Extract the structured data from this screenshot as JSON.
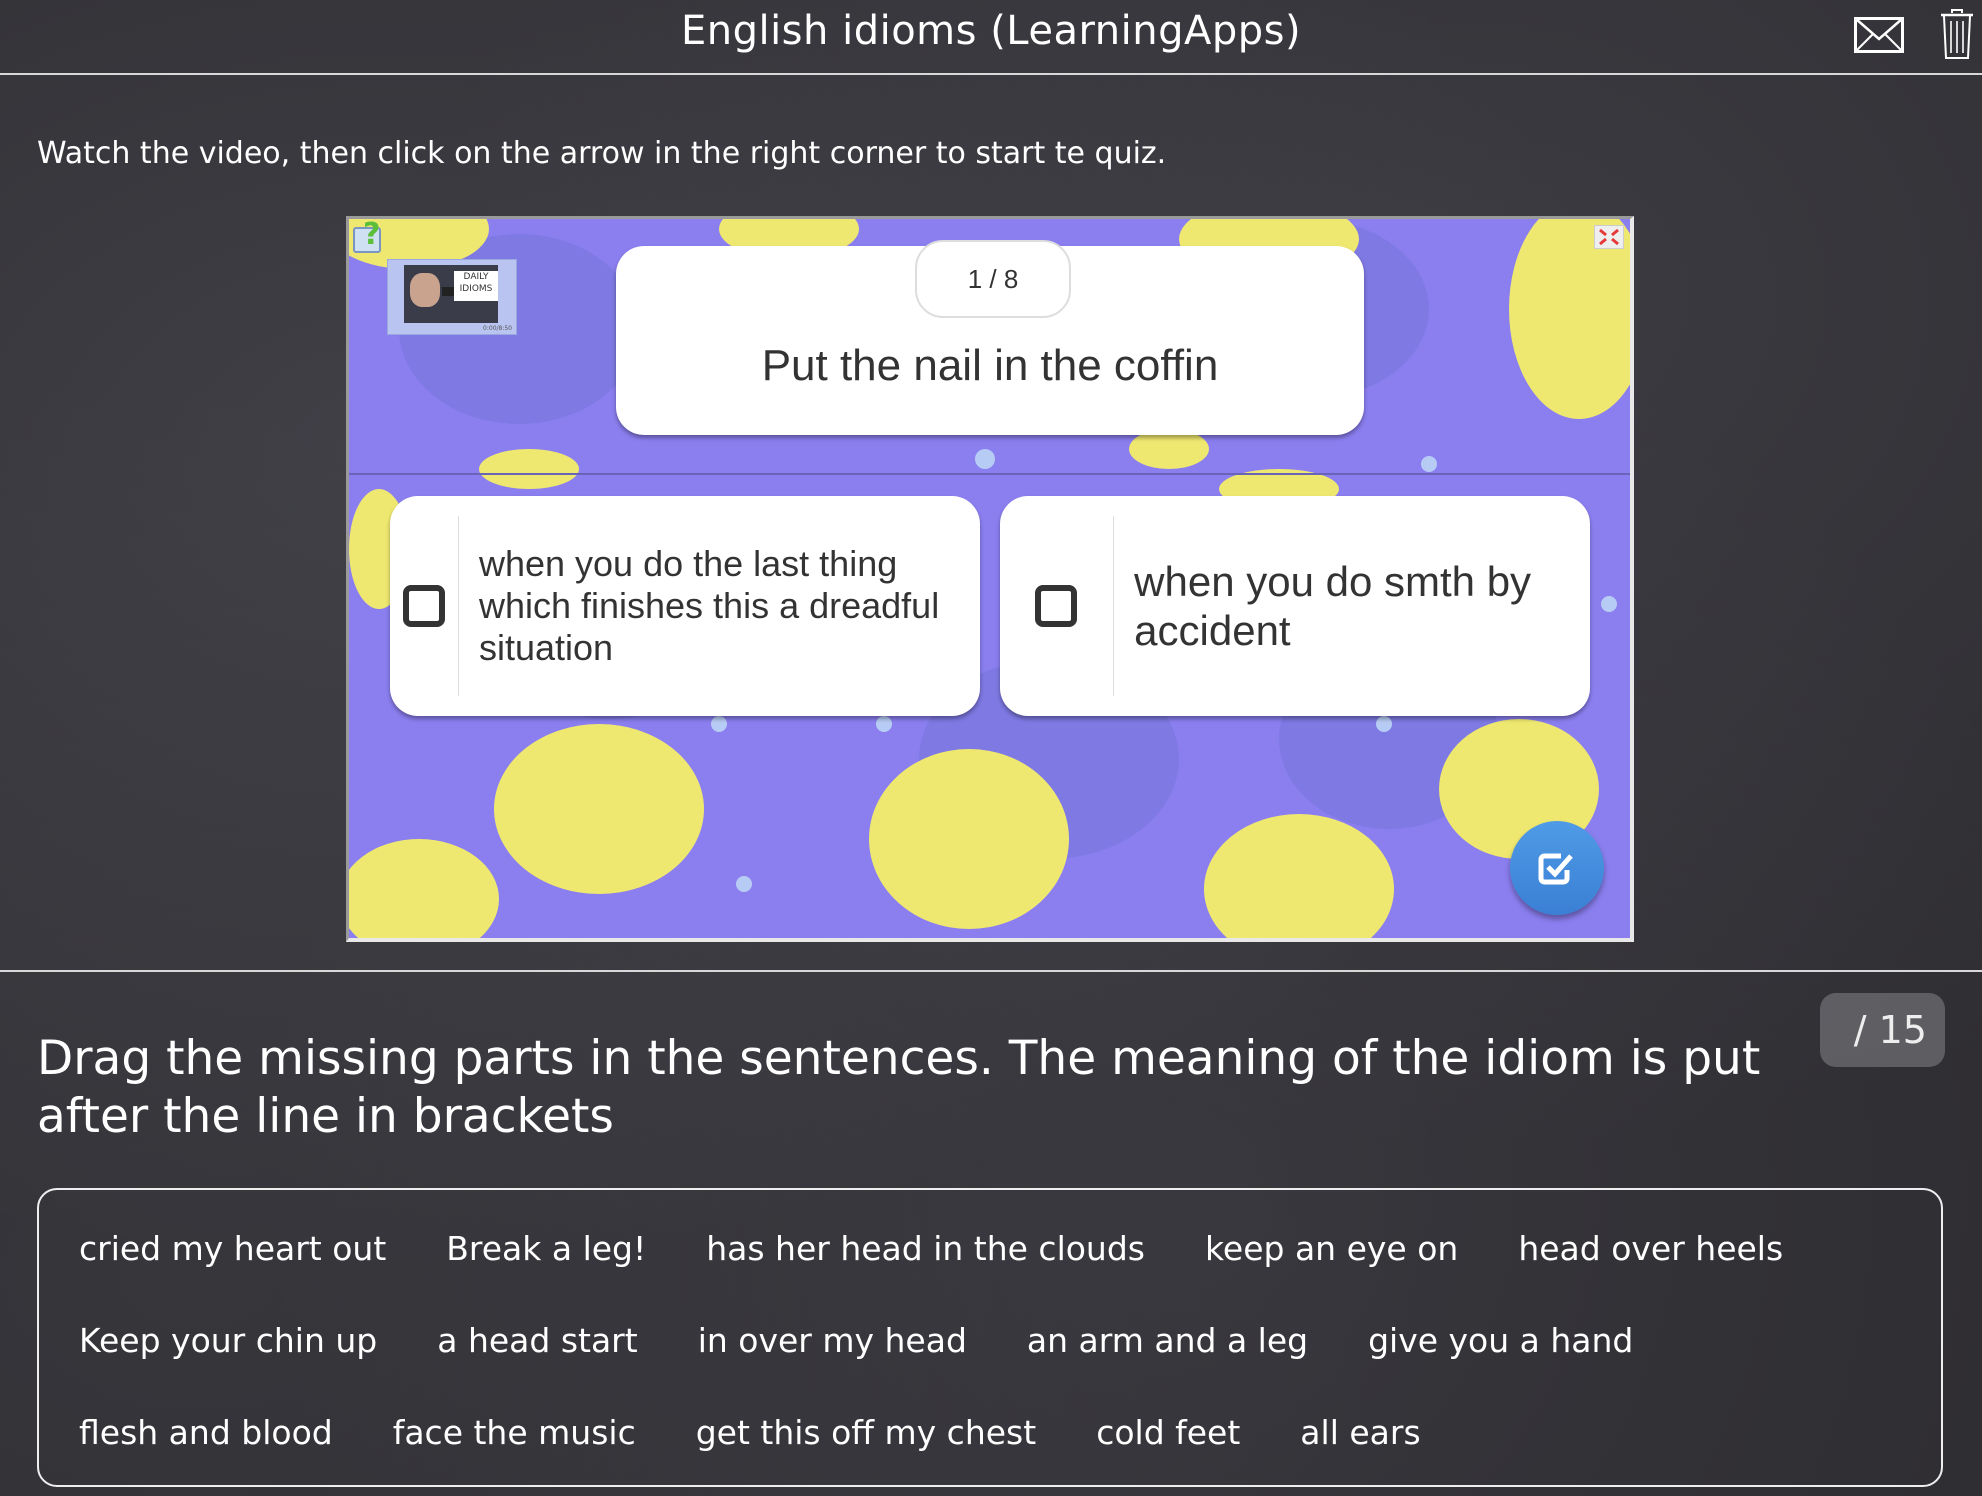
{
  "header": {
    "title": "English idioms (LearningApps)",
    "icons": [
      "mail-icon",
      "trash-icon"
    ]
  },
  "instruction": "Watch the video, then click on the arrow in the right corner to start te quiz.",
  "quiz": {
    "counter": "1 / 8",
    "question": "Put the nail in the coffin",
    "video_thumbnail": {
      "title_line1": "DAILY",
      "title_line2": "IDIOMS",
      "time": "0:00/8:50"
    },
    "answers": [
      {
        "text": "when you do the last thing which finishes this a dreadful situation",
        "checked": false
      },
      {
        "text": "when you do smth by accident",
        "checked": false
      }
    ],
    "icons": [
      "help-icon",
      "fullscreen-icon",
      "check-submit-icon"
    ],
    "colors": {
      "background": "#8b7ff0",
      "leaf": "#efe870",
      "button": "#3f86d9"
    }
  },
  "score_badge": "/ 15",
  "task_heading": "Drag the missing parts in the sentences. The meaning of the idiom is put after the line in brackets",
  "word_bank": {
    "rows": [
      [
        "cried my heart out",
        "Break a leg!",
        "has her head in the clouds",
        "keep an eye on",
        "head over heels"
      ],
      [
        "Keep your chin up",
        "a head start",
        "in over my head",
        "an arm and a leg",
        "give you a hand"
      ],
      [
        "flesh and blood",
        "face the music",
        "get this off my chest",
        "cold feet",
        "all ears"
      ]
    ]
  }
}
